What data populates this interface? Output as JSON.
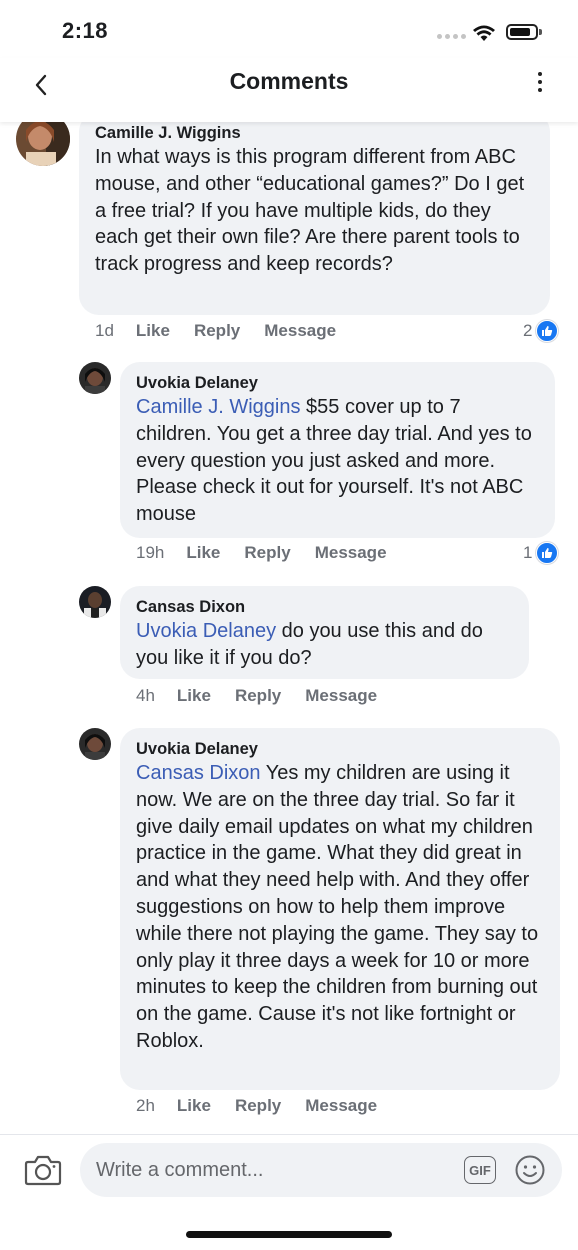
{
  "status_bar": {
    "time": "2:18"
  },
  "header": {
    "title": "Comments"
  },
  "comments": [
    {
      "author": "Camille J. Wiggins",
      "mention": "",
      "text": "In what ways is this program different from ABC mouse, and other “educational games?” Do I get a free trial? If you have multiple kids, do they each get their own file? Are there parent tools to track progress and keep records?",
      "time": "1d",
      "like_label": "Like",
      "reply_label": "Reply",
      "message_label": "Message",
      "reaction_count": "2"
    },
    {
      "author": "Uvokia Delaney",
      "mention": "Camille J. Wiggins",
      "text": " $55 cover up to 7 children. You get a three day trial. And yes to every question you just asked and more. Please check it out for yourself. It's not ABC mouse",
      "time": "19h",
      "like_label": "Like",
      "reply_label": "Reply",
      "message_label": "Message",
      "reaction_count": "1"
    },
    {
      "author": "Cansas Dixon",
      "mention": "Uvokia Delaney",
      "text": " do you use this and do you like it if you do?",
      "time": "4h",
      "like_label": "Like",
      "reply_label": "Reply",
      "message_label": "Message",
      "reaction_count": ""
    },
    {
      "author": "Uvokia Delaney",
      "mention": "Cansas Dixon",
      "text": " Yes my children are using it now. We are on the three day trial. So far it give daily email updates on what my children practice in the game. What they did great in and what they need help with. And they offer suggestions on how to help them improve while there not playing the game. They say to only play it three days a week for 10 or more minutes to keep the children from burning out on the game. Cause it's not like fortnight or Roblox.",
      "time": "2h",
      "like_label": "Like",
      "reply_label": "Reply",
      "message_label": "Message",
      "reaction_count": ""
    }
  ],
  "composer": {
    "placeholder": "Write a comment...",
    "gif_label": "GIF"
  },
  "icons": {
    "back": "chevron-left-icon",
    "more": "more-vertical-icon",
    "like": "thumbs-up-icon",
    "camera": "camera-icon",
    "emoji": "emoji-icon"
  },
  "colors": {
    "mention": "#3b5db5",
    "like_badge": "#1877f2",
    "bubble": "#f0f2f5"
  }
}
